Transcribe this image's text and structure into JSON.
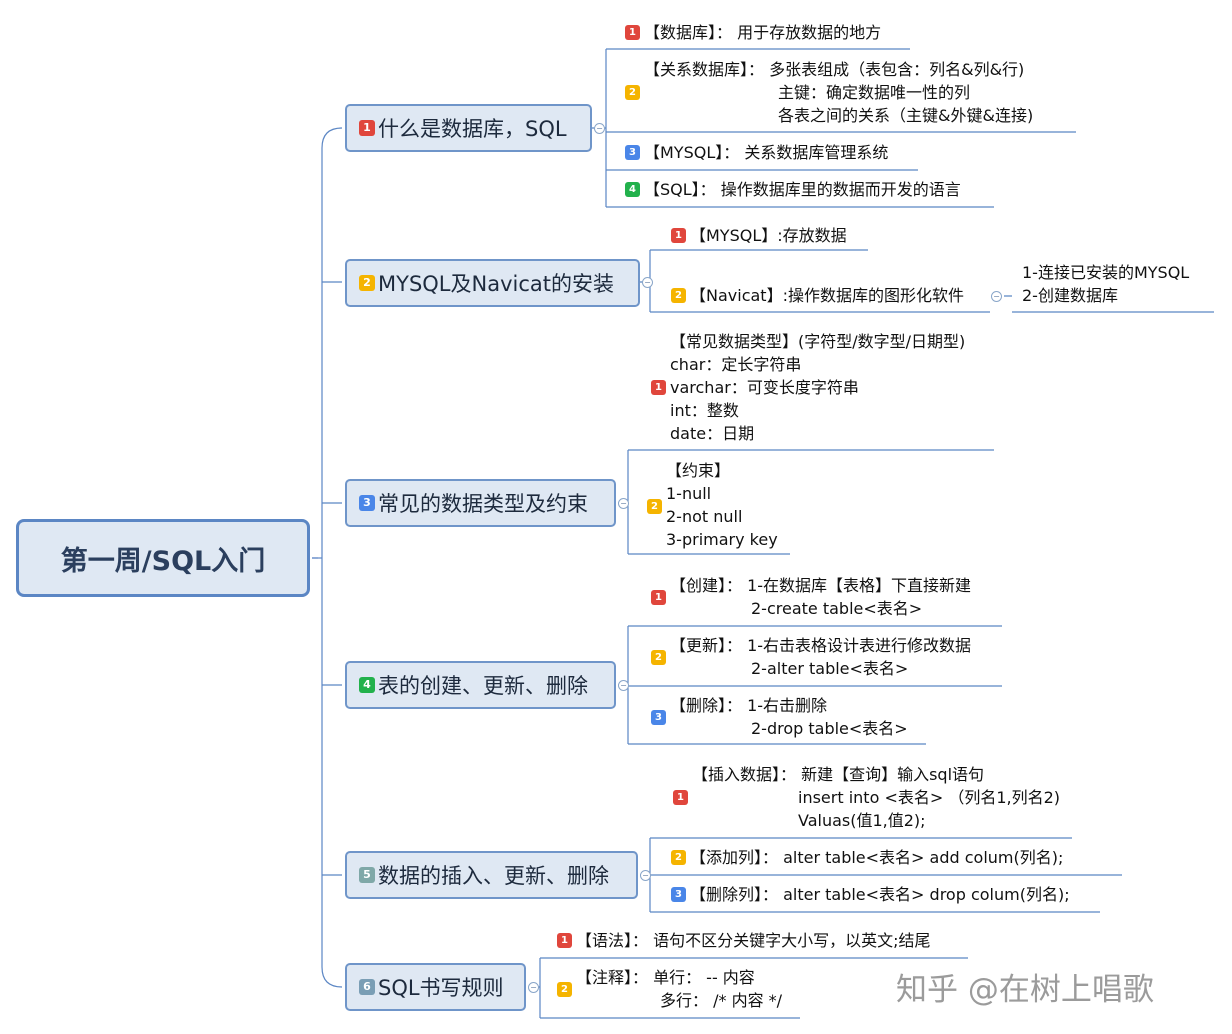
{
  "root": {
    "label": "第一周/SQL入门"
  },
  "topics": [
    {
      "num": "1",
      "label": "什么是数据库，SQL",
      "children": [
        {
          "num": "1",
          "lines": [
            "【数据库】： 用于存放数据的地方"
          ]
        },
        {
          "num": "2",
          "lines": [
            "【关系数据库】： 多张表组成（表包含：列名&列&行)",
            "主键：确定数据唯一性的列",
            "各表之间的关系（主键&外键&连接)"
          ]
        },
        {
          "num": "3",
          "lines": [
            "【MYSQL】： 关系数据库管理系统"
          ]
        },
        {
          "num": "4",
          "lines": [
            "【SQL】： 操作数据库里的数据而开发的语言"
          ]
        }
      ]
    },
    {
      "num": "2",
      "label": "MYSQL及Navicat的安装",
      "children": [
        {
          "num": "1",
          "lines": [
            "【MYSQL】:存放数据"
          ]
        },
        {
          "num": "2",
          "lines": [
            "【Navicat】:操作数据库的图形化软件"
          ]
        }
      ],
      "sub_children": [
        "1-连接已安装的MYSQL",
        "2-创建数据库"
      ]
    },
    {
      "num": "3",
      "label": "常见的数据类型及约束",
      "children": [
        {
          "num": "1",
          "lines": [
            "【常见数据类型】(字符型/数字型/日期型)",
            "char：定长字符串",
            "varchar：可变长度字符串",
            "int：整数",
            "date：日期"
          ]
        },
        {
          "num": "2",
          "lines": [
            "【约束】",
            "1-null",
            "2-not null",
            "3-primary key"
          ]
        }
      ]
    },
    {
      "num": "4",
      "label": "表的创建、更新、删除",
      "children": [
        {
          "num": "1",
          "lines": [
            "【创建】： 1-在数据库【表格】下直接新建",
            "2-create table<表名>"
          ]
        },
        {
          "num": "2",
          "lines": [
            "【更新】： 1-右击表格设计表进行修改数据",
            "2-alter table<表名>"
          ]
        },
        {
          "num": "3",
          "lines": [
            "【删除】： 1-右击删除",
            "2-drop table<表名>"
          ]
        }
      ]
    },
    {
      "num": "5",
      "label": "数据的插入、更新、删除",
      "children": [
        {
          "num": "1",
          "lines": [
            "【插入数据】： 新建【查询】输入sql语句",
            "insert into <表名> （列名1,列名2)",
            "Valuas(值1,值2);"
          ]
        },
        {
          "num": "2",
          "lines": [
            "【添加列】： alter table<表名> add colum(列名);"
          ]
        },
        {
          "num": "3",
          "lines": [
            "【删除列】： alter table<表名> drop colum(列名);"
          ]
        }
      ]
    },
    {
      "num": "6",
      "label": "SQL书写规则",
      "children": [
        {
          "num": "1",
          "lines": [
            "【语法】： 语句不区分关键字大小写，以英文;结尾"
          ]
        },
        {
          "num": "2",
          "lines": [
            "【注释】： 单行： -- 内容",
            "多行： /* 内容 */"
          ]
        }
      ]
    }
  ],
  "watermark": "知乎 @在树上唱歌",
  "colors": {
    "topic_border": "#6f95c9",
    "topic_fill": "#dfe8f3",
    "line": "#5b86c4",
    "badge1": "#e0463c",
    "badge2": "#f5b400",
    "badge3": "#4a86e8",
    "badge4": "#22b14c"
  }
}
